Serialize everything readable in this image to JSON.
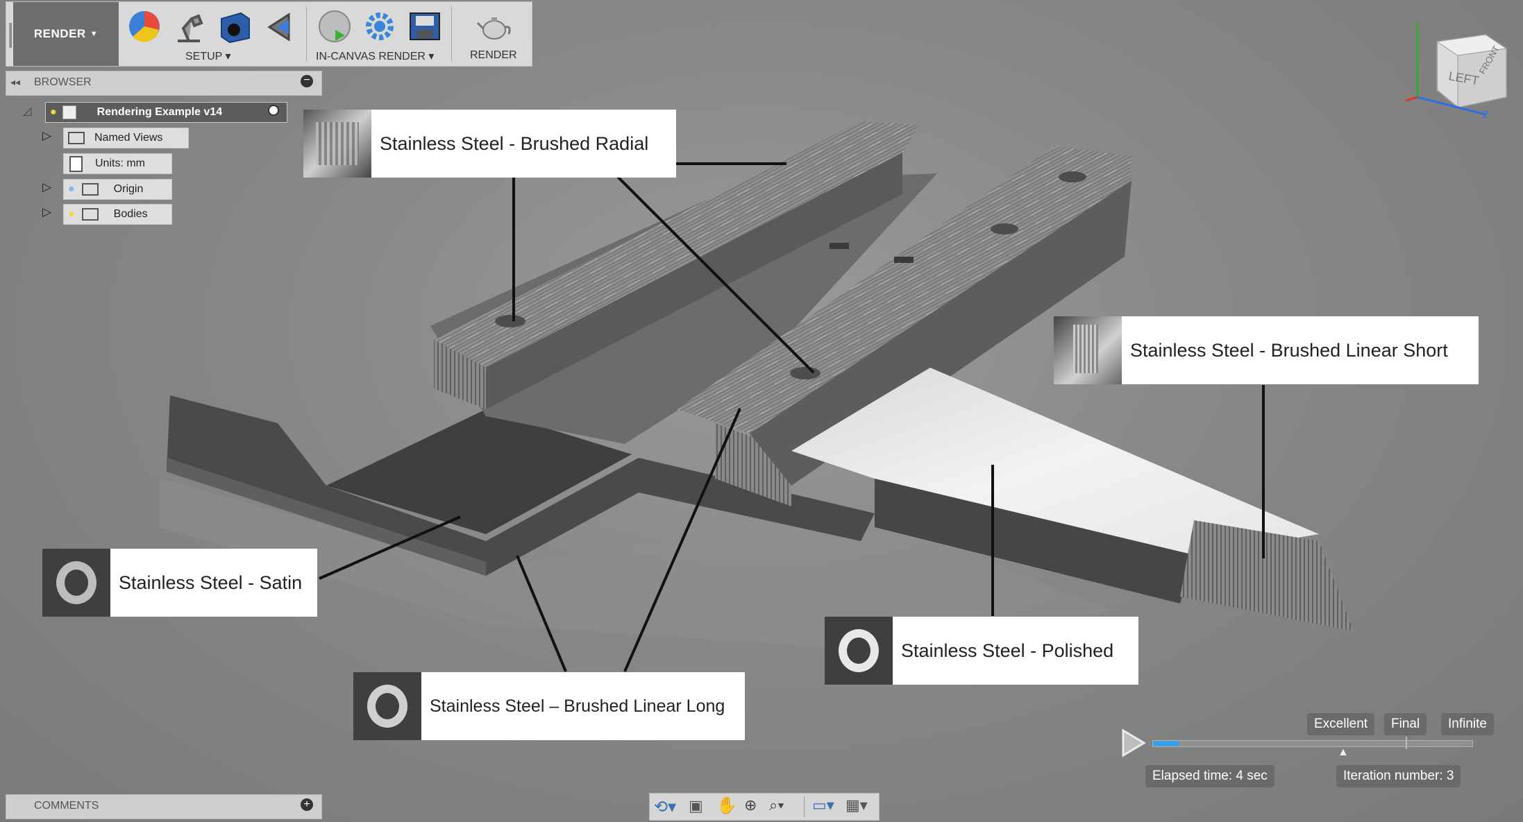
{
  "toolbar": {
    "workspace": "RENDER",
    "groups": [
      {
        "label": "SETUP"
      },
      {
        "label": "IN-CANVAS RENDER"
      },
      {
        "label": "RENDER"
      }
    ]
  },
  "browser": {
    "title": "BROWSER",
    "root": "Rendering Example v14",
    "items": [
      {
        "label": "Named Views"
      },
      {
        "label": "Units: mm"
      },
      {
        "label": "Origin"
      },
      {
        "label": "Bodies"
      }
    ]
  },
  "comments": {
    "title": "COMMENTS"
  },
  "viewcube": {
    "faces": [
      "LEFT",
      "FRONT"
    ],
    "axes": [
      "Y",
      "Z"
    ]
  },
  "callouts": [
    {
      "label": "Stainless Steel - Brushed Radial"
    },
    {
      "label": "Stainless Steel - Brushed Linear Short"
    },
    {
      "label": "Stainless Steel - Satin"
    },
    {
      "label": "Stainless Steel - Polished"
    },
    {
      "label": "Stainless Steel – Brushed Linear Long"
    }
  ],
  "render": {
    "quality_options": [
      "Excellent",
      "Final",
      "Infinite"
    ],
    "elapsed": "Elapsed time: 4 sec",
    "iteration": "Iteration number: 3",
    "progress": 0.08
  },
  "colors": {
    "toolbar_bg": "#d9d9d9",
    "viewport_bg": "#878787",
    "accent_blue": "#3aa0e6"
  }
}
